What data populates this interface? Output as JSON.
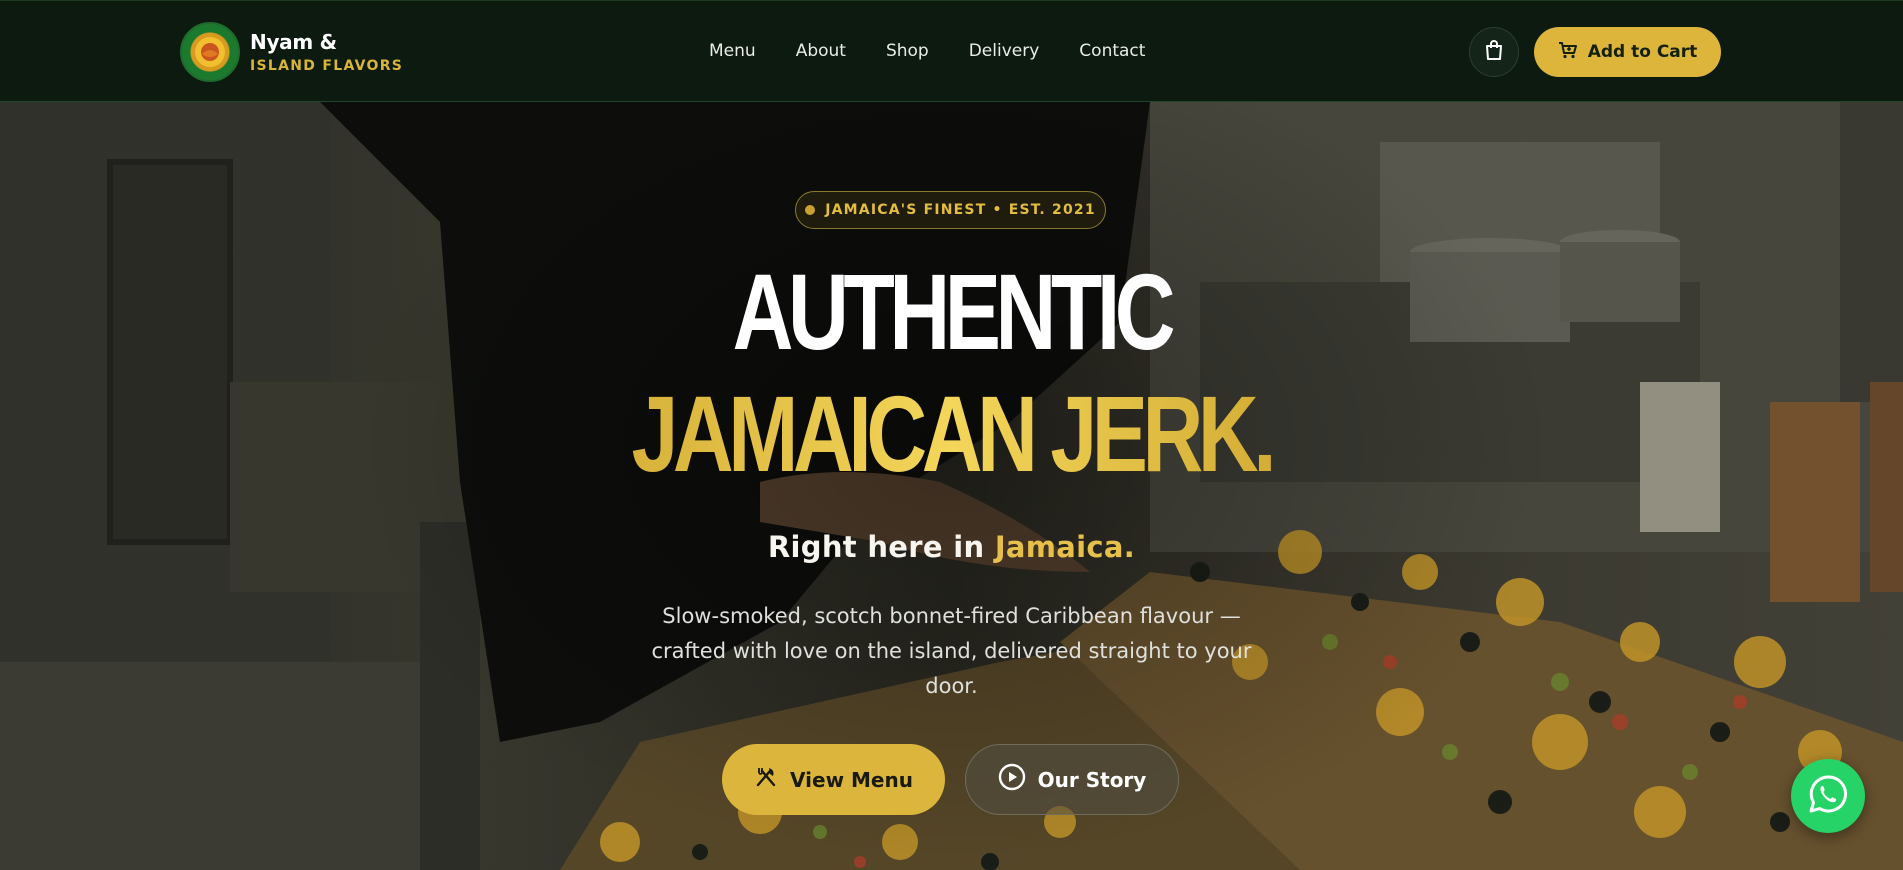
{
  "nav": {
    "brand_name": "Nyam &",
    "brand_sub": "ISLAND FLAVORS",
    "links": [
      "Menu",
      "About",
      "Shop",
      "Delivery",
      "Contact"
    ],
    "bag_icon": "shopping-bag-icon",
    "cart_label": "Add to Cart",
    "cart_icon": "cart-icon"
  },
  "hero": {
    "badge": "JAMAICA'S FINEST • EST. 2021",
    "title_line1": "AUTHENTIC",
    "title_line2": "JAMAICAN JERK.",
    "tagline_prefix": "Right here in",
    "tagline_highlight": "Jamaica.",
    "description": "Slow-smoked, scotch bonnet-fired Caribbean flavour — crafted with love on the island, delivered straight to your door.",
    "primary_button": "View Menu",
    "primary_icon": "utensils-icon",
    "secondary_button": "Our Story",
    "secondary_icon": "play-circle-icon"
  },
  "floating": {
    "whatsapp_icon": "whatsapp-icon"
  },
  "colors": {
    "nav_bg": "#0c1a10",
    "accent_gold": "#dcb53a",
    "whatsapp_green": "#25d366"
  }
}
